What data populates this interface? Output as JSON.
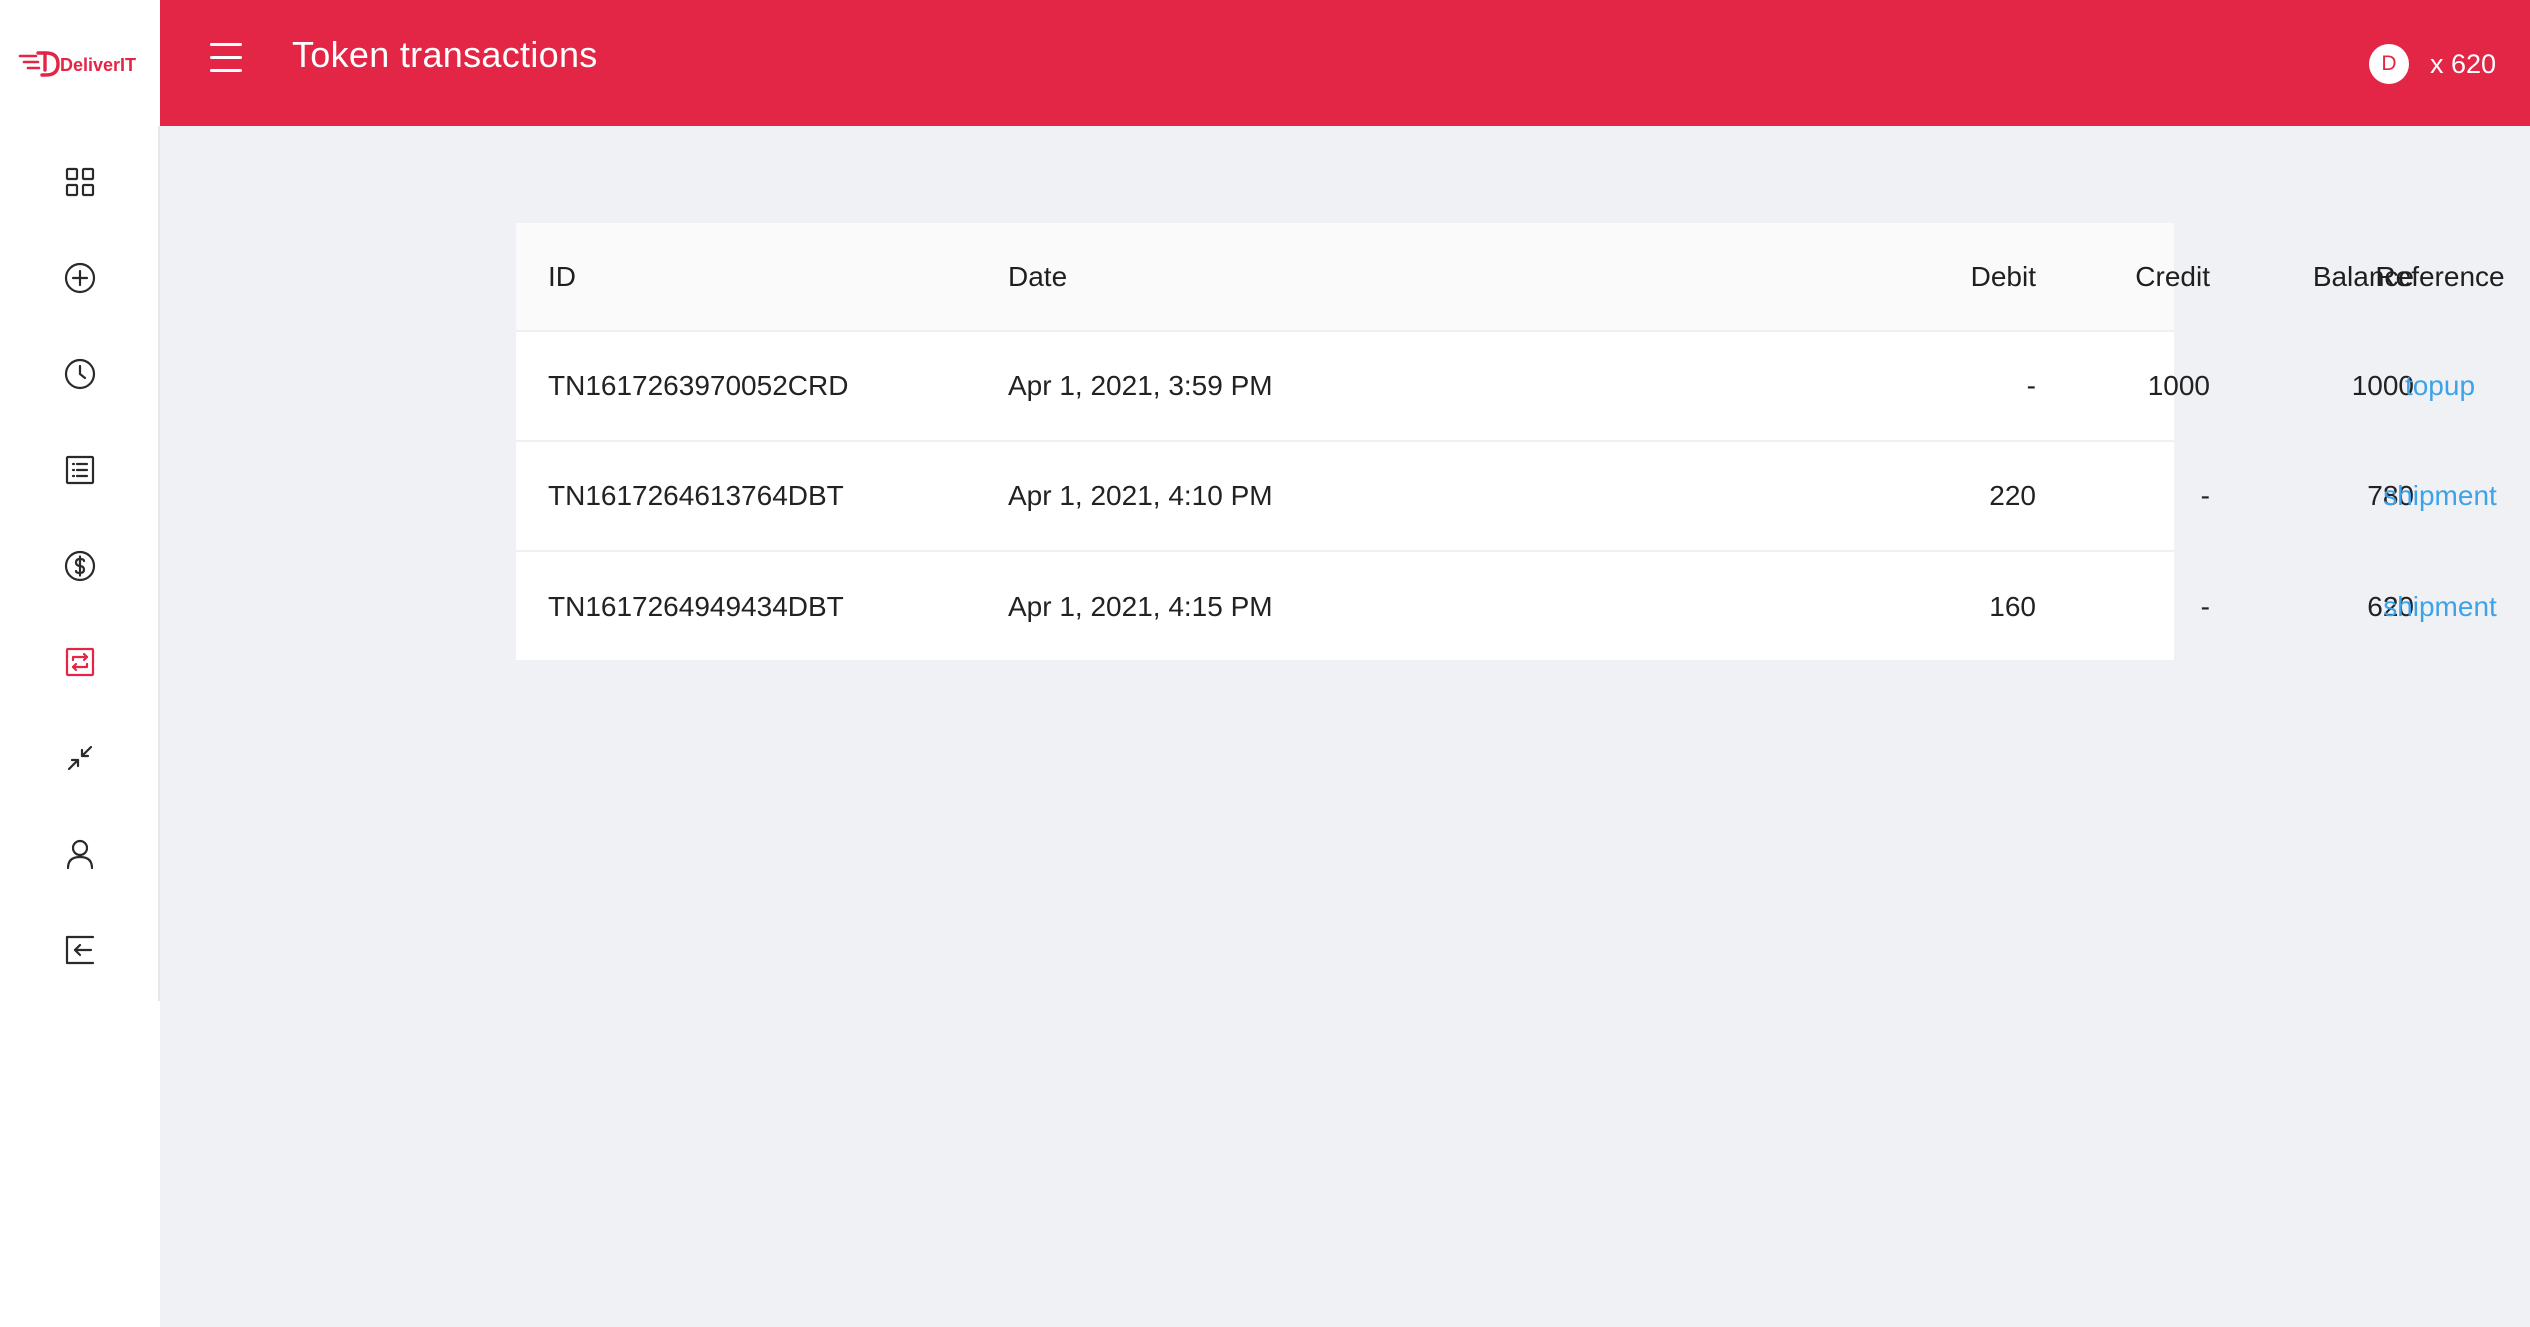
{
  "app": {
    "logo_text": "DeliverIT",
    "brand_color": "#e32546",
    "link_color": "#3da3e8"
  },
  "header": {
    "title": "Token transactions",
    "avatar_letter": "D",
    "token_balance": "x 620"
  },
  "sidebar": {
    "items": [
      {
        "icon": "grid-icon"
      },
      {
        "icon": "plus-circle-icon"
      },
      {
        "icon": "clock-icon"
      },
      {
        "icon": "list-icon"
      },
      {
        "icon": "dollar-icon"
      },
      {
        "icon": "transfer-icon",
        "active": true
      },
      {
        "icon": "minimize-icon"
      },
      {
        "icon": "user-icon"
      },
      {
        "icon": "logout-icon"
      }
    ]
  },
  "table": {
    "headers": {
      "id": "ID",
      "date": "Date",
      "debit": "Debit",
      "credit": "Credit",
      "balance": "Balance",
      "reference": "Reference"
    },
    "rows": [
      {
        "id": "TN1617263970052CRD",
        "date": "Apr 1, 2021, 3:59 PM",
        "debit": "-",
        "credit": "1000",
        "balance": "1000",
        "reference": "topup"
      },
      {
        "id": "TN1617264613764DBT",
        "date": "Apr 1, 2021, 4:10 PM",
        "debit": "220",
        "credit": "-",
        "balance": "780",
        "reference": "shipment"
      },
      {
        "id": "TN1617264949434DBT",
        "date": "Apr 1, 2021, 4:15 PM",
        "debit": "160",
        "credit": "-",
        "balance": "620",
        "reference": "shipment"
      }
    ]
  }
}
